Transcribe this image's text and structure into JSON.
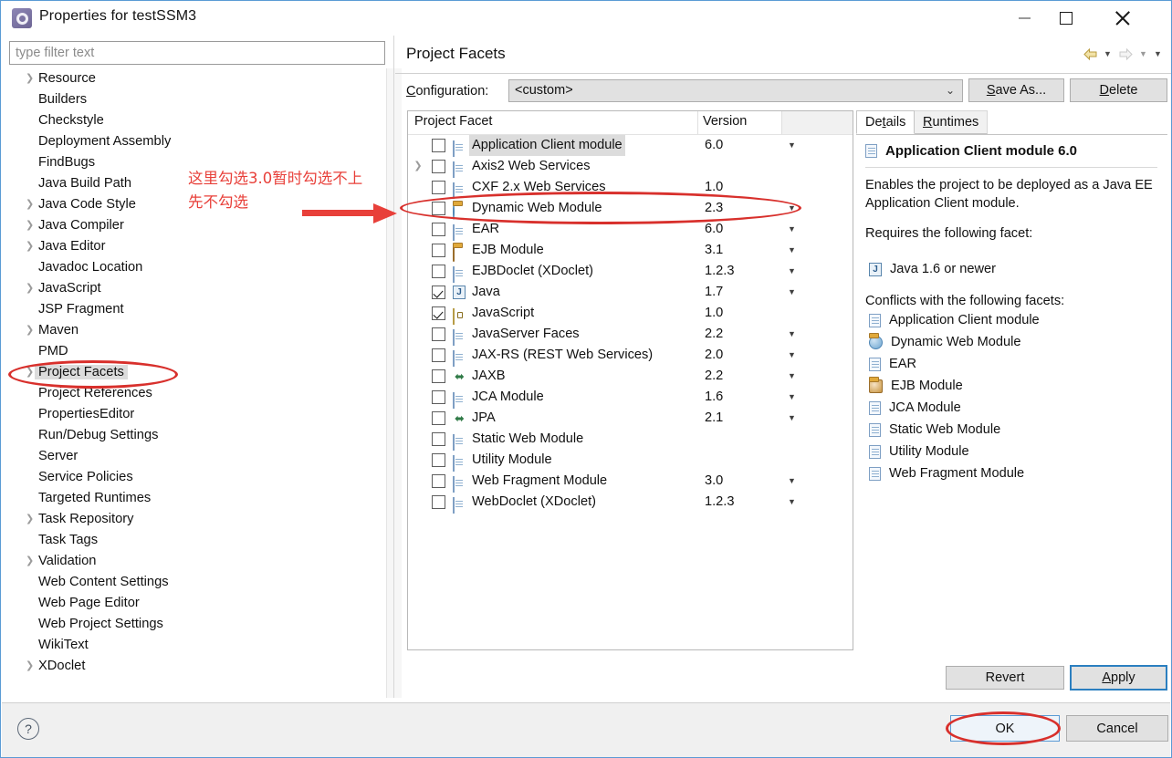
{
  "window": {
    "title": "Properties for testSSM3",
    "icon": "eclipse-properties-icon",
    "minimize_label": "Minimize",
    "maximize_label": "Maximize",
    "close_label": "Close"
  },
  "filter": {
    "placeholder": "type filter text",
    "value": ""
  },
  "sidebar": {
    "items": [
      {
        "label": "Resource",
        "expandable": true,
        "selected": false
      },
      {
        "label": "Builders",
        "expandable": false,
        "selected": false
      },
      {
        "label": "Checkstyle",
        "expandable": false,
        "selected": false
      },
      {
        "label": "Deployment Assembly",
        "expandable": false,
        "selected": false
      },
      {
        "label": "FindBugs",
        "expandable": false,
        "selected": false
      },
      {
        "label": "Java Build Path",
        "expandable": false,
        "selected": false
      },
      {
        "label": "Java Code Style",
        "expandable": true,
        "selected": false
      },
      {
        "label": "Java Compiler",
        "expandable": true,
        "selected": false
      },
      {
        "label": "Java Editor",
        "expandable": true,
        "selected": false
      },
      {
        "label": "Javadoc Location",
        "expandable": false,
        "selected": false
      },
      {
        "label": "JavaScript",
        "expandable": true,
        "selected": false
      },
      {
        "label": "JSP Fragment",
        "expandable": false,
        "selected": false
      },
      {
        "label": "Maven",
        "expandable": true,
        "selected": false
      },
      {
        "label": "PMD",
        "expandable": false,
        "selected": false
      },
      {
        "label": "Project Facets",
        "expandable": true,
        "selected": true
      },
      {
        "label": "Project References",
        "expandable": false,
        "selected": false
      },
      {
        "label": "PropertiesEditor",
        "expandable": false,
        "selected": false
      },
      {
        "label": "Run/Debug Settings",
        "expandable": false,
        "selected": false
      },
      {
        "label": "Server",
        "expandable": false,
        "selected": false
      },
      {
        "label": "Service Policies",
        "expandable": false,
        "selected": false
      },
      {
        "label": "Targeted Runtimes",
        "expandable": false,
        "selected": false
      },
      {
        "label": "Task Repository",
        "expandable": true,
        "selected": false
      },
      {
        "label": "Task Tags",
        "expandable": false,
        "selected": false
      },
      {
        "label": "Validation",
        "expandable": true,
        "selected": false
      },
      {
        "label": "Web Content Settings",
        "expandable": false,
        "selected": false
      },
      {
        "label": "Web Page Editor",
        "expandable": false,
        "selected": false
      },
      {
        "label": "Web Project Settings",
        "expandable": false,
        "selected": false
      },
      {
        "label": "WikiText",
        "expandable": false,
        "selected": false
      },
      {
        "label": "XDoclet",
        "expandable": true,
        "selected": false
      }
    ]
  },
  "page": {
    "title": "Project Facets",
    "config_label": "Configuration:",
    "config_value": "<custom>",
    "save_as_label": "Save As...",
    "delete_label": "Delete",
    "nav_back_icon": "back-arrow-icon",
    "nav_forward_icon": "forward-arrow-icon",
    "nav_menu_icon": "chevron-down-icon"
  },
  "facet_table": {
    "col_facet": "Project Facet",
    "col_version": "Version",
    "rows": [
      {
        "name": "Application Client module",
        "version": "6.0",
        "checked": false,
        "expandable": false,
        "dropdown": true,
        "icon": "doc-icon",
        "highlighted": true
      },
      {
        "name": "Axis2 Web Services",
        "version": "",
        "checked": false,
        "expandable": true,
        "dropdown": false,
        "icon": "doc-icon",
        "highlighted": false
      },
      {
        "name": "CXF 2.x Web Services",
        "version": "1.0",
        "checked": false,
        "expandable": false,
        "dropdown": false,
        "icon": "doc-icon",
        "highlighted": false
      },
      {
        "name": "Dynamic Web Module",
        "version": "2.3",
        "checked": false,
        "expandable": false,
        "dropdown": true,
        "icon": "web-module-icon",
        "highlighted": false
      },
      {
        "name": "EAR",
        "version": "6.0",
        "checked": false,
        "expandable": false,
        "dropdown": true,
        "icon": "doc-icon",
        "highlighted": false
      },
      {
        "name": "EJB Module",
        "version": "3.1",
        "checked": false,
        "expandable": false,
        "dropdown": true,
        "icon": "ejb-icon",
        "highlighted": false
      },
      {
        "name": "EJBDoclet (XDoclet)",
        "version": "1.2.3",
        "checked": false,
        "expandable": false,
        "dropdown": true,
        "icon": "doc-icon",
        "highlighted": false
      },
      {
        "name": "Java",
        "version": "1.7",
        "checked": true,
        "expandable": false,
        "dropdown": true,
        "icon": "java-icon",
        "highlighted": false
      },
      {
        "name": "JavaScript",
        "version": "1.0",
        "checked": true,
        "expandable": false,
        "dropdown": false,
        "icon": "javascript-icon",
        "highlighted": false
      },
      {
        "name": "JavaServer Faces",
        "version": "2.2",
        "checked": false,
        "expandable": false,
        "dropdown": true,
        "icon": "doc-icon",
        "highlighted": false
      },
      {
        "name": "JAX-RS (REST Web Services)",
        "version": "2.0",
        "checked": false,
        "expandable": false,
        "dropdown": true,
        "icon": "doc-icon",
        "highlighted": false
      },
      {
        "name": "JAXB",
        "version": "2.2",
        "checked": false,
        "expandable": false,
        "dropdown": true,
        "icon": "jaxb-icon",
        "highlighted": false
      },
      {
        "name": "JCA Module",
        "version": "1.6",
        "checked": false,
        "expandable": false,
        "dropdown": true,
        "icon": "doc-icon",
        "highlighted": false
      },
      {
        "name": "JPA",
        "version": "2.1",
        "checked": false,
        "expandable": false,
        "dropdown": true,
        "icon": "jaxb-icon",
        "highlighted": false
      },
      {
        "name": "Static Web Module",
        "version": "",
        "checked": false,
        "expandable": false,
        "dropdown": false,
        "icon": "doc-icon",
        "highlighted": false
      },
      {
        "name": "Utility Module",
        "version": "",
        "checked": false,
        "expandable": false,
        "dropdown": false,
        "icon": "doc-icon",
        "highlighted": false
      },
      {
        "name": "Web Fragment Module",
        "version": "3.0",
        "checked": false,
        "expandable": false,
        "dropdown": true,
        "icon": "doc-icon",
        "highlighted": false
      },
      {
        "name": "WebDoclet (XDoclet)",
        "version": "1.2.3",
        "checked": false,
        "expandable": false,
        "dropdown": true,
        "icon": "doc-icon",
        "highlighted": false
      }
    ]
  },
  "details": {
    "tab_details": "Details",
    "tab_runtimes": "Runtimes",
    "heading": "Application Client module 6.0",
    "description": "Enables the project to be deployed as a Java EE Application Client module.",
    "requires_label": "Requires the following facet:",
    "requires": [
      {
        "label": "Java 1.6 or newer",
        "icon": "java-icon"
      }
    ],
    "conflicts_label": "Conflicts with the following facets:",
    "conflicts": [
      {
        "label": "Application Client module",
        "icon": "doc-icon"
      },
      {
        "label": "Dynamic Web Module",
        "icon": "web-module-icon"
      },
      {
        "label": "EAR",
        "icon": "doc-icon"
      },
      {
        "label": "EJB Module",
        "icon": "ejb-icon"
      },
      {
        "label": "JCA Module",
        "icon": "doc-icon"
      },
      {
        "label": "Static Web Module",
        "icon": "doc-icon"
      },
      {
        "label": "Utility Module",
        "icon": "doc-icon"
      },
      {
        "label": "Web Fragment Module",
        "icon": "doc-icon"
      }
    ]
  },
  "buttons": {
    "revert": "Revert",
    "apply": "Apply",
    "ok": "OK",
    "cancel": "Cancel",
    "help_icon": "help-icon"
  },
  "annotations": {
    "note_line1": "这里勾选3.0暂时勾选不上",
    "note_line2": "先不勾选",
    "color": "#e8403a",
    "ellipse_color": "#d8302c"
  }
}
